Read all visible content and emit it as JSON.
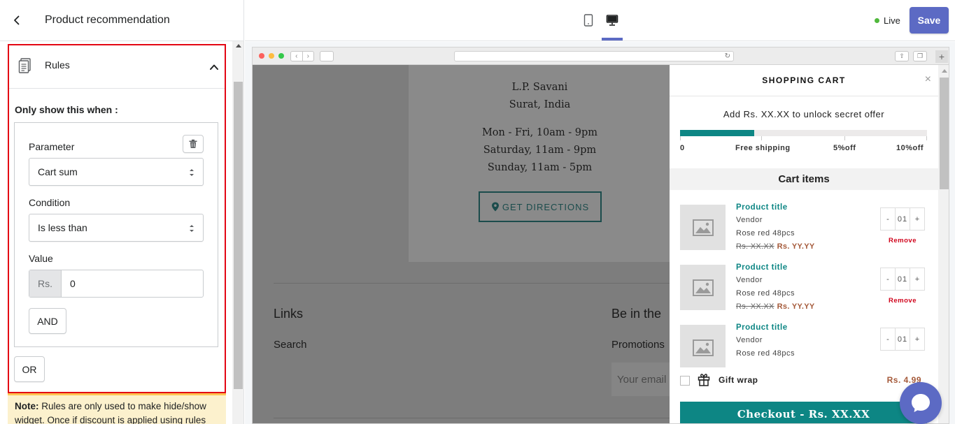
{
  "header": {
    "title": "Product recommendation"
  },
  "topbar": {
    "live_label": "Live",
    "save_label": "Save",
    "status_color": "#50b83c",
    "accent_color": "#5c6ac4"
  },
  "rules": {
    "section_label": "Rules",
    "only_show_label": "Only show this when :",
    "parameter_label": "Parameter",
    "parameter_value": "Cart sum",
    "condition_label": "Condition",
    "condition_value": "Is less than",
    "value_label": "Value",
    "value_prefix": "Rs.",
    "value_amount": "0",
    "and_label": "AND",
    "or_label": "OR",
    "note_bold": "Note:",
    "note_text": " Rules are only used to make hide/show widget. Once if discount is applied using rules"
  },
  "preview": {
    "store": {
      "address_line1": "L.P. Savani",
      "address_line2": "Surat, India",
      "hours_line1": "Mon - Fri, 10am - 9pm",
      "hours_line2": "Saturday, 11am - 9pm",
      "hours_line3": "Sunday, 11am - 5pm",
      "directions_label": "GET DIRECTIONS"
    },
    "footer": {
      "links_title": "Links",
      "search_link": "Search",
      "newsletter_title": "Be in the",
      "promotions_text": "Promotions",
      "email_placeholder": "Your email"
    }
  },
  "cart": {
    "title": "SHOPPING CART",
    "close_symbol": "×",
    "unlock_text": "Add Rs. XX.XX to unlock secret offer",
    "progress_fraction": 0.3,
    "milestones": [
      {
        "label": "0"
      },
      {
        "label": "Free shipping"
      },
      {
        "label": "5%off"
      },
      {
        "label": "10%off"
      }
    ],
    "items_title": "Cart items",
    "items": [
      {
        "title": "Product title",
        "vendor": "Vendor",
        "variant": "Rose red 48pcs",
        "old_price": "Rs. XX.XX",
        "new_price": "Rs. YY.YY",
        "qty": "01",
        "minus": "-",
        "plus": "+",
        "remove": "Remove"
      },
      {
        "title": "Product title",
        "vendor": "Vendor",
        "variant": "Rose red 48pcs",
        "old_price": "Rs. XX.XX",
        "new_price": "Rs. YY.YY",
        "qty": "01",
        "minus": "-",
        "plus": "+",
        "remove": "Remove"
      },
      {
        "title": "Product title",
        "vendor": "Vendor",
        "variant": "Rose red 48pcs",
        "old_price": "",
        "new_price": "",
        "qty": "01",
        "minus": "-",
        "plus": "+",
        "remove": ""
      }
    ],
    "gift_label": "Gift wrap",
    "gift_price": "Rs. 4.99",
    "checkout_label": "Checkout - Rs. XX.XX",
    "brand_color": "#0d8684"
  }
}
